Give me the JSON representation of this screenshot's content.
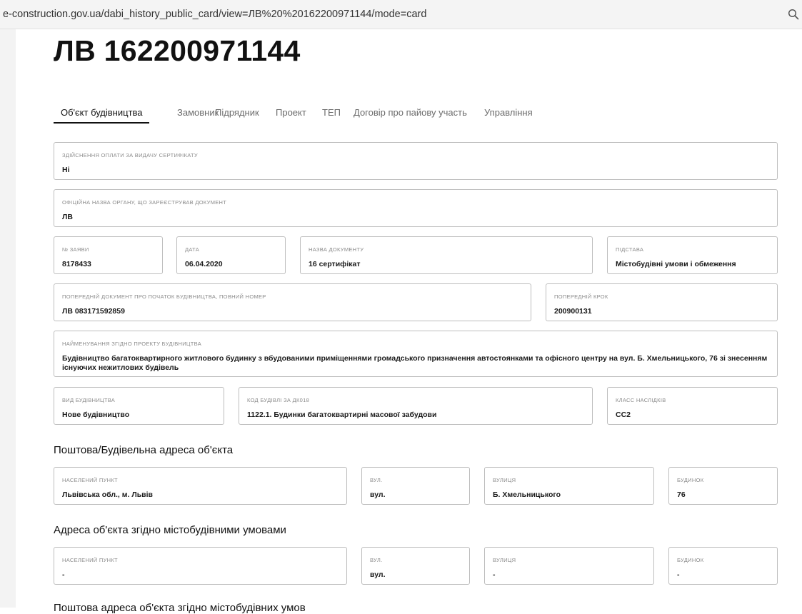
{
  "browser": {
    "url": "e-construction.gov.ua/dabi_history_public_card/view=ЛВ%20%20162200971144/mode=card"
  },
  "page_title": "ЛВ 162200971144",
  "tabs": [
    {
      "label": "Об'єкт будівництва",
      "active": true
    },
    {
      "label": "Замовник"
    },
    {
      "label": "Підрядник"
    },
    {
      "label": "Проект"
    },
    {
      "label": "ТЕП"
    },
    {
      "label": "Договір про пайову участь"
    },
    {
      "label": "Управління"
    }
  ],
  "fields": {
    "payment": {
      "label": "Здійснення оплати за видачу сертифікату",
      "value": "Ні"
    },
    "authority": {
      "label": "Офіційна назва органу, що зареєстрував документ",
      "value": "ЛВ"
    },
    "application_no": {
      "label": "№ заяви",
      "value": "8178433"
    },
    "date": {
      "label": "Дата",
      "value": "06.04.2020"
    },
    "doc_name": {
      "label": "Назва документу",
      "value": "16 сертифікат"
    },
    "basis": {
      "label": "Підстава",
      "value": "Містобудівні умови і обмеження"
    },
    "prev_doc": {
      "label": "Попередній документ про початок будівництва, повний номер",
      "value": "ЛВ 083171592859"
    },
    "prev_step": {
      "label": "Попередній крок",
      "value": "200900131"
    },
    "project_name": {
      "label": "Найменування згідно проекту будівництва",
      "value": "Будівництво багатоквартирного житлового будинку з вбудованими приміщеннями громадського призначення автостоянками та офісного центру на вул. Б. Хмельницького, 76 зі знесенням існуючих нежитлових будівель"
    },
    "construction_type": {
      "label": "Вид будівництва",
      "value": "Нове будівництво"
    },
    "building_code": {
      "label": "Код будівлі за ДК018",
      "value": "1122.1. Будинки багатоквартирні масової забудови"
    },
    "consequence_class": {
      "label": "Класс наслідків",
      "value": "СС2"
    }
  },
  "postal_address": {
    "title": "Поштова/Будівельна адреса об'єкта",
    "settlement": {
      "label": "Населений пункт",
      "value": "Львівська обл., м. Львів"
    },
    "street_type": {
      "label": "Вул.",
      "value": "вул."
    },
    "street": {
      "label": "Вулиця",
      "value": "Б. Хмельницького"
    },
    "building": {
      "label": "Будинок",
      "value": "76"
    }
  },
  "urban_address": {
    "title": "Адреса об'єкта згідно містобудівними умовами",
    "settlement": {
      "label": "Населений пункт",
      "value": "-"
    },
    "street_type": {
      "label": "Вул.",
      "value": "вул."
    },
    "street": {
      "label": "Вулиця",
      "value": "-"
    },
    "building": {
      "label": "Будинок",
      "value": "-"
    }
  },
  "next_section_partial": "Поштова адреса об'єкта згідно містобудівних умов"
}
